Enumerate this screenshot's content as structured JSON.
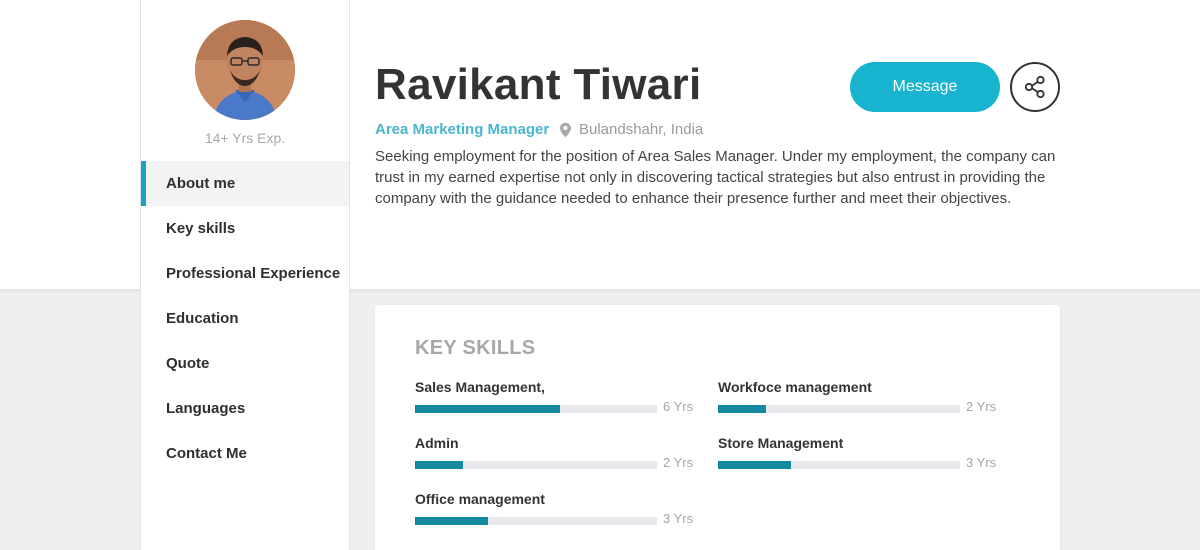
{
  "profile": {
    "name": "Ravikant Tiwari",
    "role": "Area Marketing Manager",
    "location": "Bulandshahr, India",
    "experience": "14+ Yrs Exp.",
    "summary": "Seeking employment for the position of Area Sales Manager. Under my employment, the company can trust in my earned expertise not only in discovering tactical strategies but also entrust in providing the company with the guidance needed to enhance their presence further and meet their objectives."
  },
  "actions": {
    "message_label": "Message",
    "share_icon": "share-icon"
  },
  "nav": {
    "items": [
      {
        "label": "About me",
        "active": true
      },
      {
        "label": "Key skills",
        "active": false
      },
      {
        "label": "Professional Experience",
        "active": false
      },
      {
        "label": "Education",
        "active": false
      },
      {
        "label": "Quote",
        "active": false
      },
      {
        "label": "Languages",
        "active": false
      },
      {
        "label": "Contact Me",
        "active": false
      }
    ]
  },
  "key_skills": {
    "title": "KEY SKILLS",
    "items": [
      {
        "name": "Sales Management,",
        "years": "6 Yrs",
        "level": 0.6
      },
      {
        "name": "Workfoce management",
        "years": "2 Yrs",
        "level": 0.2
      },
      {
        "name": "Admin",
        "years": "2 Yrs",
        "level": 0.2
      },
      {
        "name": "Store Management",
        "years": "3 Yrs",
        "level": 0.3
      },
      {
        "name": "Office management",
        "years": "3 Yrs",
        "level": 0.3
      }
    ]
  },
  "colors": {
    "accent": "#18b3cf",
    "accent_text": "#4cb6cc",
    "skill_bar": "#13899f",
    "nav_active_border": "#1aa3bf"
  }
}
